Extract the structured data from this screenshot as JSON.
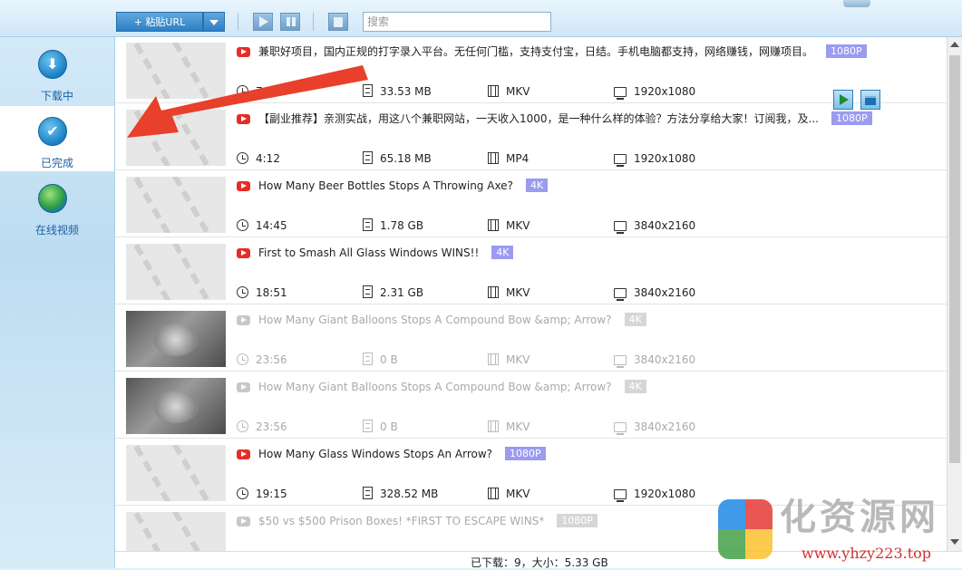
{
  "toolbar": {
    "paste_url_label": "+ 粘贴URL",
    "search_placeholder": "搜索"
  },
  "sidebar": {
    "items": [
      {
        "label": "下载中",
        "icon": "download-icon"
      },
      {
        "label": "已完成",
        "icon": "check-icon",
        "active": true
      },
      {
        "label": "在线视频",
        "icon": "globe-icon"
      }
    ]
  },
  "videos": [
    {
      "title": "兼职好项目，国内正规的打字录入平台。无任何门槛，支持支付宝，日结。手机电脑都支持，网络赚钱，网赚项目。",
      "quality": "1080P",
      "duration": "7:...",
      "size": "33.53 MB",
      "format": "MKV",
      "resolution": "1920x1080",
      "dim": false
    },
    {
      "title": "【副业推荐】亲测实战，用这八个兼职网站，一天收入1000，是一种什么样的体验？方法分享给大家！订阅我，及...",
      "quality": "1080P",
      "duration": "4:12",
      "size": "65.18 MB",
      "format": "MP4",
      "resolution": "1920x1080",
      "dim": false
    },
    {
      "title": "How Many Beer Bottles Stops A Throwing Axe?",
      "quality": "4K",
      "duration": "14:45",
      "size": "1.78 GB",
      "format": "MKV",
      "resolution": "3840x2160",
      "dim": false
    },
    {
      "title": "First to Smash All Glass Windows WINS!!",
      "quality": "4K",
      "duration": "18:51",
      "size": "2.31 GB",
      "format": "MKV",
      "resolution": "3840x2160",
      "dim": false
    },
    {
      "title": "How Many Giant Balloons Stops A Compound Bow &amp; Arrow?",
      "quality": "4K",
      "duration": "23:56",
      "size": "0 B",
      "format": "MKV",
      "resolution": "3840x2160",
      "dim": true
    },
    {
      "title": "How Many Giant Balloons Stops A Compound Bow &amp; Arrow?",
      "quality": "4K",
      "duration": "23:56",
      "size": "0 B",
      "format": "MKV",
      "resolution": "3840x2160",
      "dim": true
    },
    {
      "title": "How Many Glass Windows Stops An Arrow?",
      "quality": "1080P",
      "duration": "19:15",
      "size": "328.52 MB",
      "format": "MKV",
      "resolution": "1920x1080",
      "dim": false
    },
    {
      "title": "$50 vs $500 Prison Boxes! *FIRST TO ESCAPE WINS*",
      "quality": "1080P",
      "duration": "",
      "size": "",
      "format": "",
      "resolution": "",
      "dim": true
    }
  ],
  "status": {
    "text": "已下载：9，大小：5.33 GB"
  },
  "watermark": {
    "site_name": "化资源网",
    "url": "www.yhzy223.top"
  },
  "colors": {
    "accent": "#2f7fc4",
    "badge": "#9b9bf0",
    "youtube_red": "#e52d27",
    "annotation_arrow": "#e8402a"
  }
}
